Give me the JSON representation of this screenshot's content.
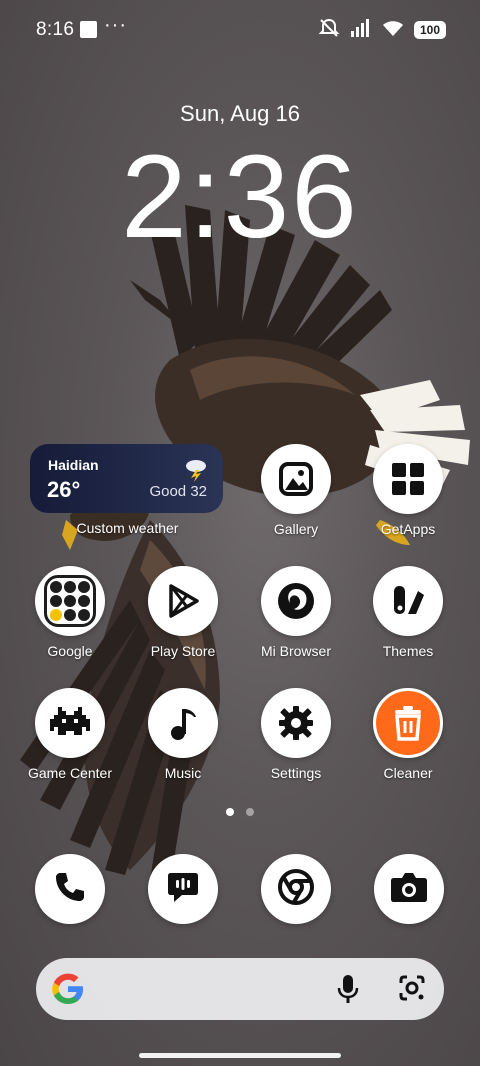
{
  "status_bar": {
    "time": "8:16",
    "dots": "···",
    "battery": "100"
  },
  "lockclock": {
    "date": "Sun, Aug 16",
    "time": "2:36"
  },
  "weather": {
    "city": "Haidian",
    "temp": "26°",
    "aqi": "Good 32",
    "label": "Custom weather",
    "icon": "thunderstorm-icon"
  },
  "apps": [
    {
      "label": "Gallery",
      "icon": "gallery-icon"
    },
    {
      "label": "GetApps",
      "icon": "getapps-icon"
    },
    {
      "label": "Google",
      "icon": "google-folder-icon"
    },
    {
      "label": "Play Store",
      "icon": "play-store-icon"
    },
    {
      "label": "Mi Browser",
      "icon": "mi-browser-icon"
    },
    {
      "label": "Themes",
      "icon": "themes-icon"
    },
    {
      "label": "Game Center",
      "icon": "game-center-icon"
    },
    {
      "label": "Music",
      "icon": "music-icon"
    },
    {
      "label": "Settings",
      "icon": "settings-icon"
    },
    {
      "label": "Cleaner",
      "icon": "cleaner-icon"
    }
  ],
  "page_indicator": {
    "pages": 2,
    "current": 1
  },
  "dock": [
    {
      "icon": "phone-icon"
    },
    {
      "icon": "messages-icon"
    },
    {
      "icon": "chrome-icon"
    },
    {
      "icon": "camera-icon"
    }
  ],
  "search_bar": {
    "icons": [
      "google-g-icon",
      "microphone-icon",
      "lens-icon"
    ]
  },
  "colors": {
    "cleaner_accent": "#ff6a1a",
    "weather_bg": "#1b2240"
  }
}
